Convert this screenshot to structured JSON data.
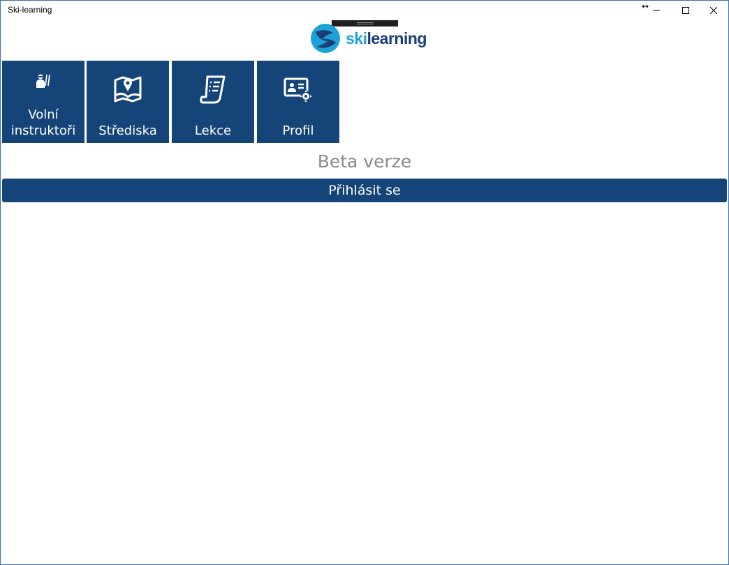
{
  "window": {
    "title": "Ski-learning"
  },
  "logo": {
    "text_ski": "ski",
    "text_learning": "learning",
    "colors": {
      "ski": "#1ea0d8",
      "learning": "#1a3f73"
    }
  },
  "tiles": [
    {
      "label": "Volní instruktoři",
      "icon": "skier-instructor-icon"
    },
    {
      "label": "Střediska",
      "icon": "map-pin-icon"
    },
    {
      "label": "Lekce",
      "icon": "document-list-icon"
    },
    {
      "label": "Profil",
      "icon": "profile-card-settings-icon"
    }
  ],
  "beta_label": "Beta verze",
  "login_button": {
    "label": "Přihlásit se"
  },
  "colors": {
    "accent": "#154478",
    "beta_text": "#8a8a8a"
  }
}
